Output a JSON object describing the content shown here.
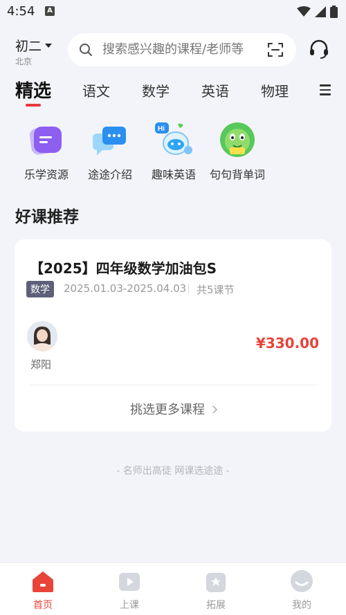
{
  "status_bar": {
    "time": "4:54"
  },
  "header": {
    "grade": "初二",
    "city": "北京",
    "search_placeholder": "搜索感兴趣的课程/老师等"
  },
  "tabs": [
    "精选",
    "语文",
    "数学",
    "英语",
    "物理"
  ],
  "quick_links": [
    "乐学资源",
    "途途介绍",
    "趣味英语",
    "句句背单词"
  ],
  "section_title": "好课推荐",
  "course": {
    "title": "【2025】四年级数学加油包S",
    "subject": "数学",
    "dates": "2025.01.03-2025.04.03",
    "lessons": "共5课节",
    "teacher": "郑阳",
    "price": "¥330.00",
    "more_label": "挑选更多课程"
  },
  "slogan": "- 名师出高徒 网课选途途 -",
  "bottom_nav": [
    "首页",
    "上课",
    "拓展",
    "我的"
  ],
  "colors": {
    "accent": "#e8443a",
    "tag_bg": "#5d6078"
  }
}
